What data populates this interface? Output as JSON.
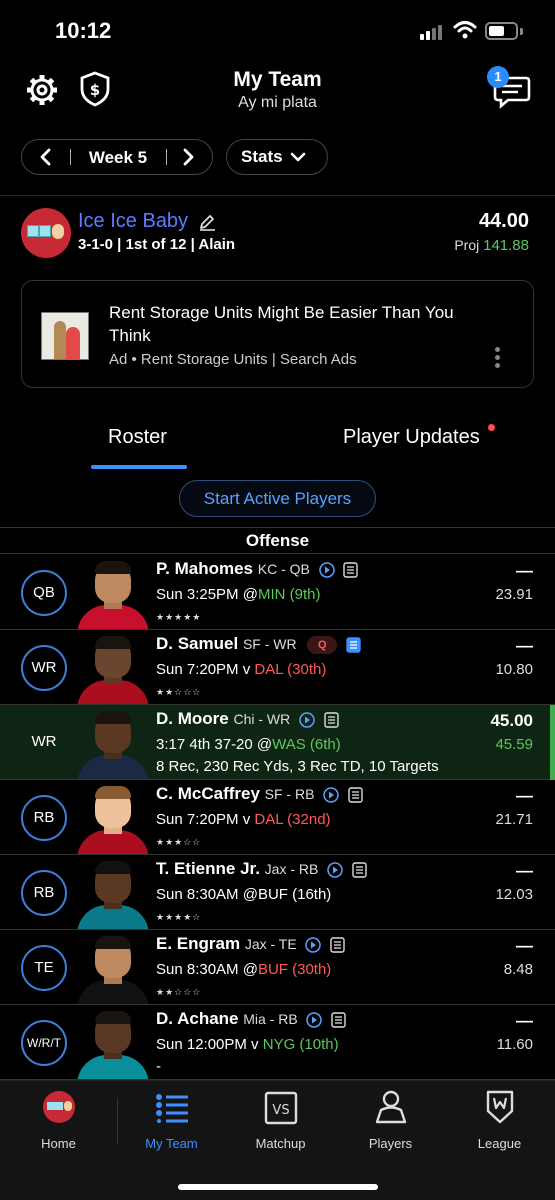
{
  "status_bar": {
    "time": "10:12",
    "battery_level": 0.6
  },
  "header": {
    "title": "My Team",
    "subtitle": "Ay mi plata",
    "chat_badge": "1"
  },
  "controls": {
    "week_label": "Week 5",
    "stats_label": "Stats"
  },
  "team": {
    "name": "Ice Ice Baby",
    "record": "3-1-0 | 1st of 12 | Alain",
    "score": "44.00",
    "proj_label": "Proj",
    "proj_value": "141.88"
  },
  "ad": {
    "title": "Rent Storage Units Might Be Easier Than You Think",
    "meta": "Ad • Rent Storage Units | Search Ads"
  },
  "tabs": {
    "roster": "Roster",
    "updates": "Player Updates"
  },
  "start_active_label": "Start Active Players",
  "section_offense": "Offense",
  "players": [
    {
      "pos": "QB",
      "name": "P. Mahomes",
      "team_pos": "KC - QB",
      "time": "Sun 3:25PM @",
      "opp": "MIN (9th)",
      "stars": "★★★★★",
      "score": "—",
      "proj": "23.91"
    },
    {
      "pos": "WR",
      "name": "D. Samuel",
      "team_pos": "SF - WR",
      "status": "Q",
      "time": "Sun 7:20PM v ",
      "opp": "DAL (30th)",
      "stars": "★★☆☆☆",
      "score": "—",
      "proj": "10.80"
    },
    {
      "pos": "WR",
      "name": "D. Moore",
      "team_pos": "Chi - WR",
      "time": "3:17 4th 37-20 @",
      "opp": "WAS (6th)",
      "line3": "8 Rec, 230 Rec Yds, 3 Rec TD, 10 Targets",
      "score": "45.00",
      "proj": "45.59"
    },
    {
      "pos": "RB",
      "name": "C. McCaffrey",
      "team_pos": "SF - RB",
      "time": "Sun 7:20PM v ",
      "opp": "DAL (32nd)",
      "stars": "★★★☆☆",
      "score": "—",
      "proj": "21.71"
    },
    {
      "pos": "RB",
      "name": "T. Etienne Jr.",
      "team_pos": "Jax - RB",
      "time": "Sun 8:30AM @",
      "opp": "BUF (16th)",
      "stars": "★★★★☆",
      "score": "—",
      "proj": "12.03"
    },
    {
      "pos": "TE",
      "name": "E. Engram",
      "team_pos": "Jax - TE",
      "time": "Sun 8:30AM @",
      "opp": "BUF (30th)",
      "stars": "★★☆☆☆",
      "score": "—",
      "proj": "8.48"
    },
    {
      "pos": "W/R/T",
      "name": "D. Achane",
      "team_pos": "Mia - RB",
      "time": "Sun 12:00PM v ",
      "opp": "NYG (10th)",
      "line3": "-",
      "score": "—",
      "proj": "11.60"
    }
  ],
  "nav": {
    "home": "Home",
    "my_team": "My Team",
    "matchup": "Matchup",
    "matchup_icon_text": "VS",
    "players": "Players",
    "league": "League"
  }
}
